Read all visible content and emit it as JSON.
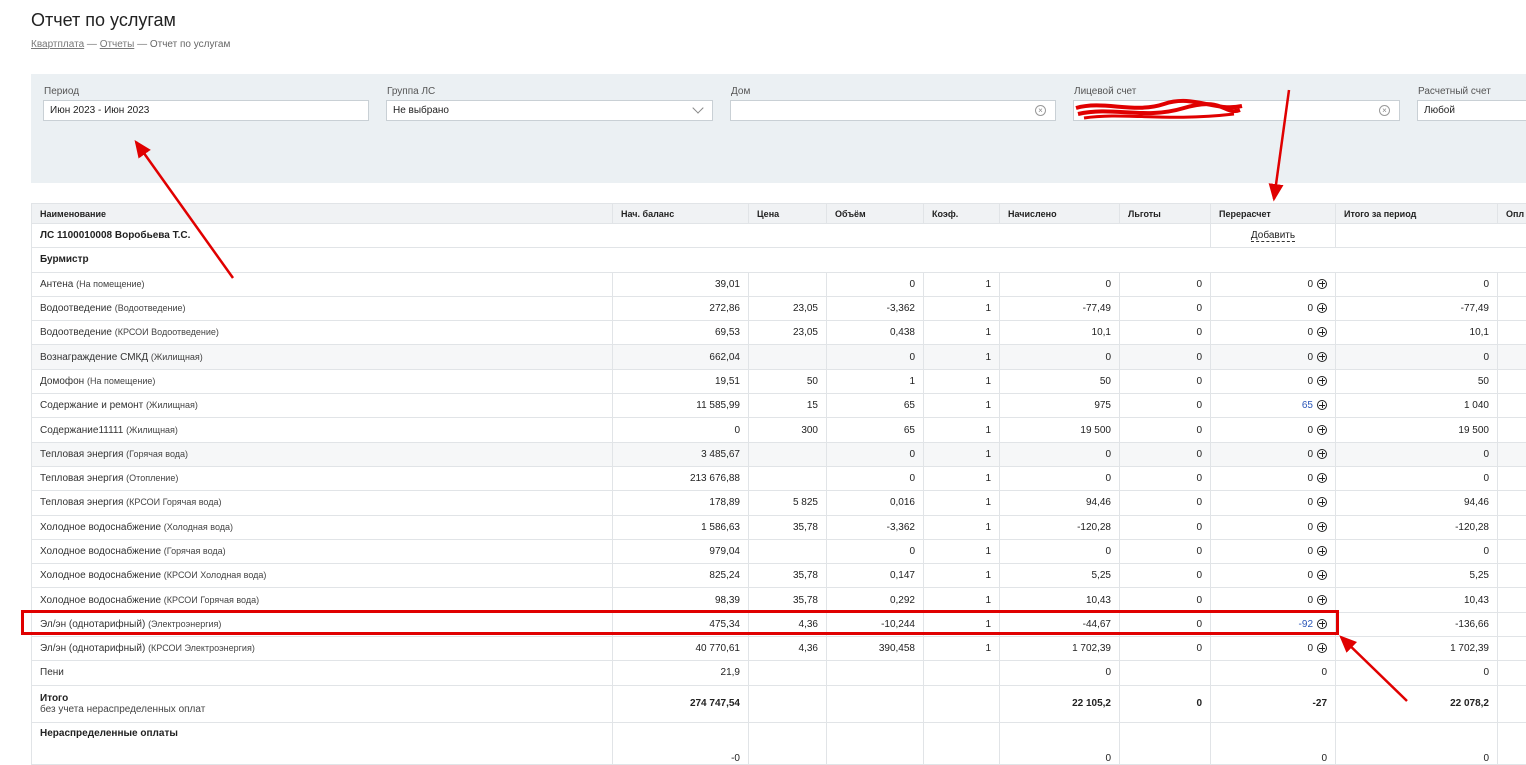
{
  "page": {
    "title": "Отчет по услугам",
    "breadcrumb": [
      "Квартплата",
      "Отчеты",
      "Отчет по услугам"
    ],
    "separator": "—"
  },
  "filters": {
    "period": {
      "label": "Период",
      "value": "Июн 2023 - Июн 2023"
    },
    "group": {
      "label": "Группа ЛС",
      "value": "Не выбрано"
    },
    "house": {
      "label": "Дом",
      "value": ""
    },
    "account": {
      "label": "Лицевой счет",
      "value": ""
    },
    "settlement": {
      "label": "Расчетный счет",
      "value": "Любой"
    }
  },
  "table": {
    "columns": [
      "Наименование",
      "Нач. баланс",
      "Цена",
      "Объём",
      "Коэф.",
      "Начислено",
      "Льготы",
      "Перерасчет",
      "Итого за период",
      "Опл"
    ],
    "account_row": {
      "name": "ЛС 1100010008 Воробьева Т.С.",
      "add_label": "Добавить"
    },
    "section": "Бурмистр",
    "rows": [
      {
        "name": "Антена",
        "sub": "(На помещение)",
        "bal": "39,01",
        "price": "",
        "vol": "0",
        "coef": "1",
        "acc": "0",
        "priv": "0",
        "recalc": "0",
        "total": "0"
      },
      {
        "name": "Водоотведение",
        "sub": "(Водоотведение)",
        "bal": "272,86",
        "price": "23,05",
        "vol": "-3,362",
        "coef": "1",
        "acc": "-77,49",
        "priv": "0",
        "recalc": "0",
        "total": "-77,49"
      },
      {
        "name": "Водоотведение",
        "sub": "(КРСОИ Водоотведение)",
        "bal": "69,53",
        "price": "23,05",
        "vol": "0,438",
        "coef": "1",
        "acc": "10,1",
        "priv": "0",
        "recalc": "0",
        "total": "10,1"
      },
      {
        "name": "Вознаграждение СМКД",
        "sub": "(Жилищная)",
        "bal": "662,04",
        "price": "",
        "vol": "0",
        "coef": "1",
        "acc": "0",
        "priv": "0",
        "recalc": "0",
        "total": "0"
      },
      {
        "name": "Домофон",
        "sub": "(На помещение)",
        "bal": "19,51",
        "price": "50",
        "vol": "1",
        "coef": "1",
        "acc": "50",
        "priv": "0",
        "recalc": "0",
        "total": "50"
      },
      {
        "name": "Содержание и ремонт",
        "sub": "(Жилищная)",
        "bal": "11 585,99",
        "price": "15",
        "vol": "65",
        "coef": "1",
        "acc": "975",
        "priv": "0",
        "recalc": "65",
        "total": "1 040"
      },
      {
        "name": "Содержание11111",
        "sub": "(Жилищная)",
        "bal": "0",
        "price": "300",
        "vol": "65",
        "coef": "1",
        "acc": "19 500",
        "priv": "0",
        "recalc": "0",
        "total": "19 500"
      },
      {
        "name": "Тепловая энергия",
        "sub": "(Горячая вода)",
        "bal": "3 485,67",
        "price": "",
        "vol": "0",
        "coef": "1",
        "acc": "0",
        "priv": "0",
        "recalc": "0",
        "total": "0"
      },
      {
        "name": "Тепловая энергия",
        "sub": "(Отопление)",
        "bal": "213 676,88",
        "price": "",
        "vol": "0",
        "coef": "1",
        "acc": "0",
        "priv": "0",
        "recalc": "0",
        "total": "0"
      },
      {
        "name": "Тепловая энергия",
        "sub": "(КРСОИ Горячая вода)",
        "bal": "178,89",
        "price": "5 825",
        "vol": "0,016",
        "coef": "1",
        "acc": "94,46",
        "priv": "0",
        "recalc": "0",
        "total": "94,46"
      },
      {
        "name": "Холодное водоснабжение",
        "sub": "(Холодная вода)",
        "bal": "1 586,63",
        "price": "35,78",
        "vol": "-3,362",
        "coef": "1",
        "acc": "-120,28",
        "priv": "0",
        "recalc": "0",
        "total": "-120,28"
      },
      {
        "name": "Холодное водоснабжение",
        "sub": "(Горячая вода)",
        "bal": "979,04",
        "price": "",
        "vol": "0",
        "coef": "1",
        "acc": "0",
        "priv": "0",
        "recalc": "0",
        "total": "0"
      },
      {
        "name": "Холодное водоснабжение",
        "sub": "(КРСОИ Холодная вода)",
        "bal": "825,24",
        "price": "35,78",
        "vol": "0,147",
        "coef": "1",
        "acc": "5,25",
        "priv": "0",
        "recalc": "0",
        "total": "5,25"
      },
      {
        "name": "Холодное водоснабжение",
        "sub": "(КРСОИ Горячая вода)",
        "bal": "98,39",
        "price": "35,78",
        "vol": "0,292",
        "coef": "1",
        "acc": "10,43",
        "priv": "0",
        "recalc": "0",
        "total": "10,43"
      },
      {
        "name": "Эл/эн (однотарифный)",
        "sub": "(Электроэнергия)",
        "bal": "475,34",
        "price": "4,36",
        "vol": "-10,244",
        "coef": "1",
        "acc": "-44,67",
        "priv": "0",
        "recalc": "-92",
        "total": "-136,66"
      },
      {
        "name": "Эл/эн (однотарифный)",
        "sub": "(КРСОИ Электроэнергия)",
        "bal": "40 770,61",
        "price": "4,36",
        "vol": "390,458",
        "coef": "1",
        "acc": "1 702,39",
        "priv": "0",
        "recalc": "0",
        "total": "1 702,39"
      },
      {
        "name": "Пени",
        "sub": "",
        "bal": "21,9",
        "price": "",
        "vol": "",
        "coef": "",
        "acc": "0",
        "priv": "",
        "recalc": "0",
        "total": "0"
      }
    ],
    "total": {
      "label": "Итого",
      "sub": "без учета нераспределенных оплат",
      "bal": "274 747,54",
      "acc": "22 105,2",
      "priv": "0",
      "recalc": "-27",
      "total": "22 078,2"
    },
    "unallocated": {
      "label": "Нераспределенные оплаты",
      "bal": "-0",
      "acc": "0",
      "recalc": "0",
      "total": "0"
    }
  },
  "annotation_color": "#e00000"
}
